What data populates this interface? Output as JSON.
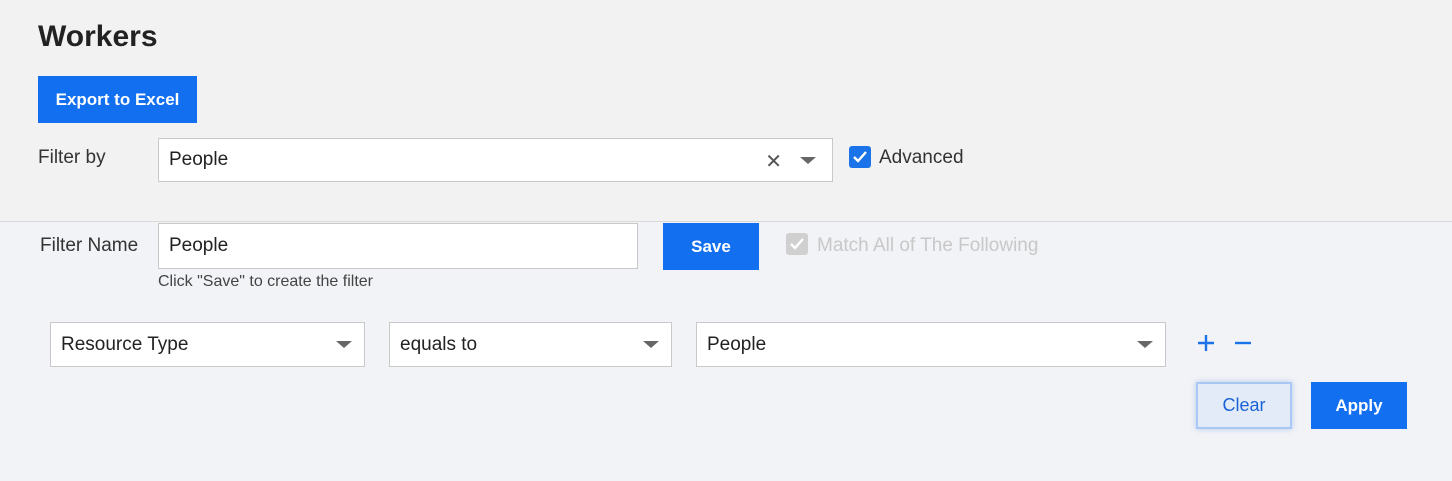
{
  "page": {
    "title": "Workers"
  },
  "toolbar": {
    "export_label": "Export to Excel"
  },
  "filter_by": {
    "label": "Filter by",
    "selected": "People",
    "clear_glyph": "✕",
    "advanced_label": "Advanced",
    "advanced_checked": true
  },
  "filter_name": {
    "label": "Filter Name",
    "value": "People",
    "hint": "Click \"Save\" to create the filter",
    "save_label": "Save",
    "match_all_label": "Match All of The Following",
    "match_all_checked": true
  },
  "condition": {
    "field": "Resource Type",
    "operator": "equals to",
    "value": "People"
  },
  "actions": {
    "clear_label": "Clear",
    "apply_label": "Apply"
  },
  "colors": {
    "primary": "#1270f0",
    "checkbox_active": "#1a73e8",
    "checkbox_disabled": "#d0d0d0",
    "disabled_text": "#c8c8c8"
  },
  "icons": {
    "clear": "close-icon",
    "dropdown": "chevron-down-icon",
    "check": "checkmark-icon",
    "add": "plus-icon",
    "remove": "minus-icon"
  }
}
